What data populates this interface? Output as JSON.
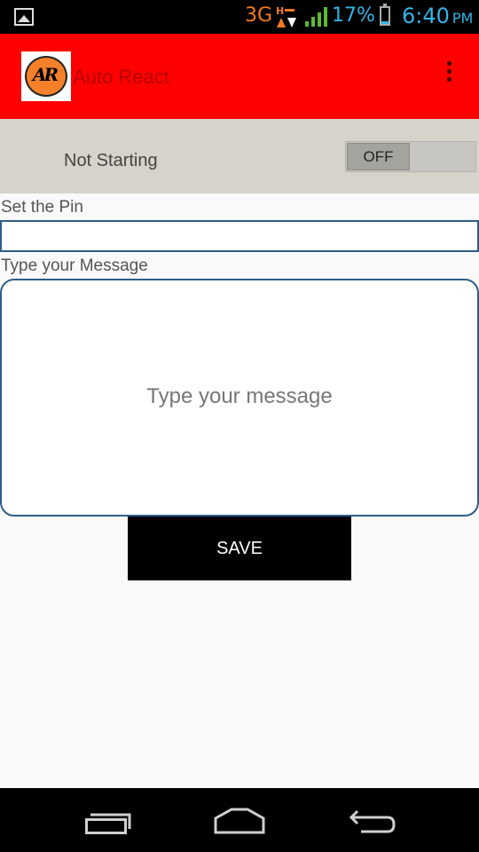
{
  "status_bar": {
    "network": "3G",
    "network_sub": "H",
    "battery_percent": "17%",
    "battery_level": 0.17,
    "time": "6:40",
    "ampm": "PM"
  },
  "action_bar": {
    "logo_text": "AR",
    "title": "Auto React",
    "color": "#ff0000"
  },
  "toggle_panel": {
    "status_text": "Not Starting",
    "switch_label": "OFF",
    "switch_on": false
  },
  "form": {
    "pin_label": "Set the Pin",
    "pin_value": "",
    "message_label": "Type your Message",
    "message_placeholder": "Type your message",
    "message_value": ""
  },
  "save_button": {
    "label": "SAVE"
  },
  "nav_bar": {
    "icons": [
      "recent-apps-icon",
      "home-icon",
      "back-icon"
    ]
  }
}
